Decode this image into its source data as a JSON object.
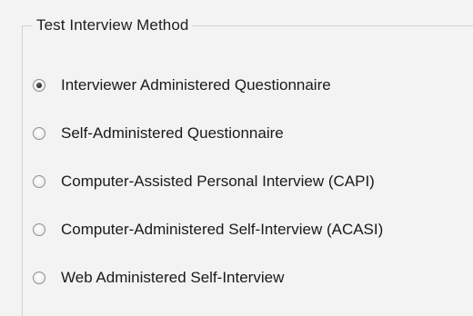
{
  "group": {
    "title": "Test Interview Method"
  },
  "options": [
    {
      "label": "Interviewer Administered Questionnaire",
      "checked": true
    },
    {
      "label": "Self-Administered Questionnaire",
      "checked": false
    },
    {
      "label": "Computer-Assisted Personal Interview (CAPI)",
      "checked": false
    },
    {
      "label": "Computer-Administered Self-Interview (ACASI)",
      "checked": false
    },
    {
      "label": "Web Administered Self-Interview",
      "checked": false
    }
  ]
}
